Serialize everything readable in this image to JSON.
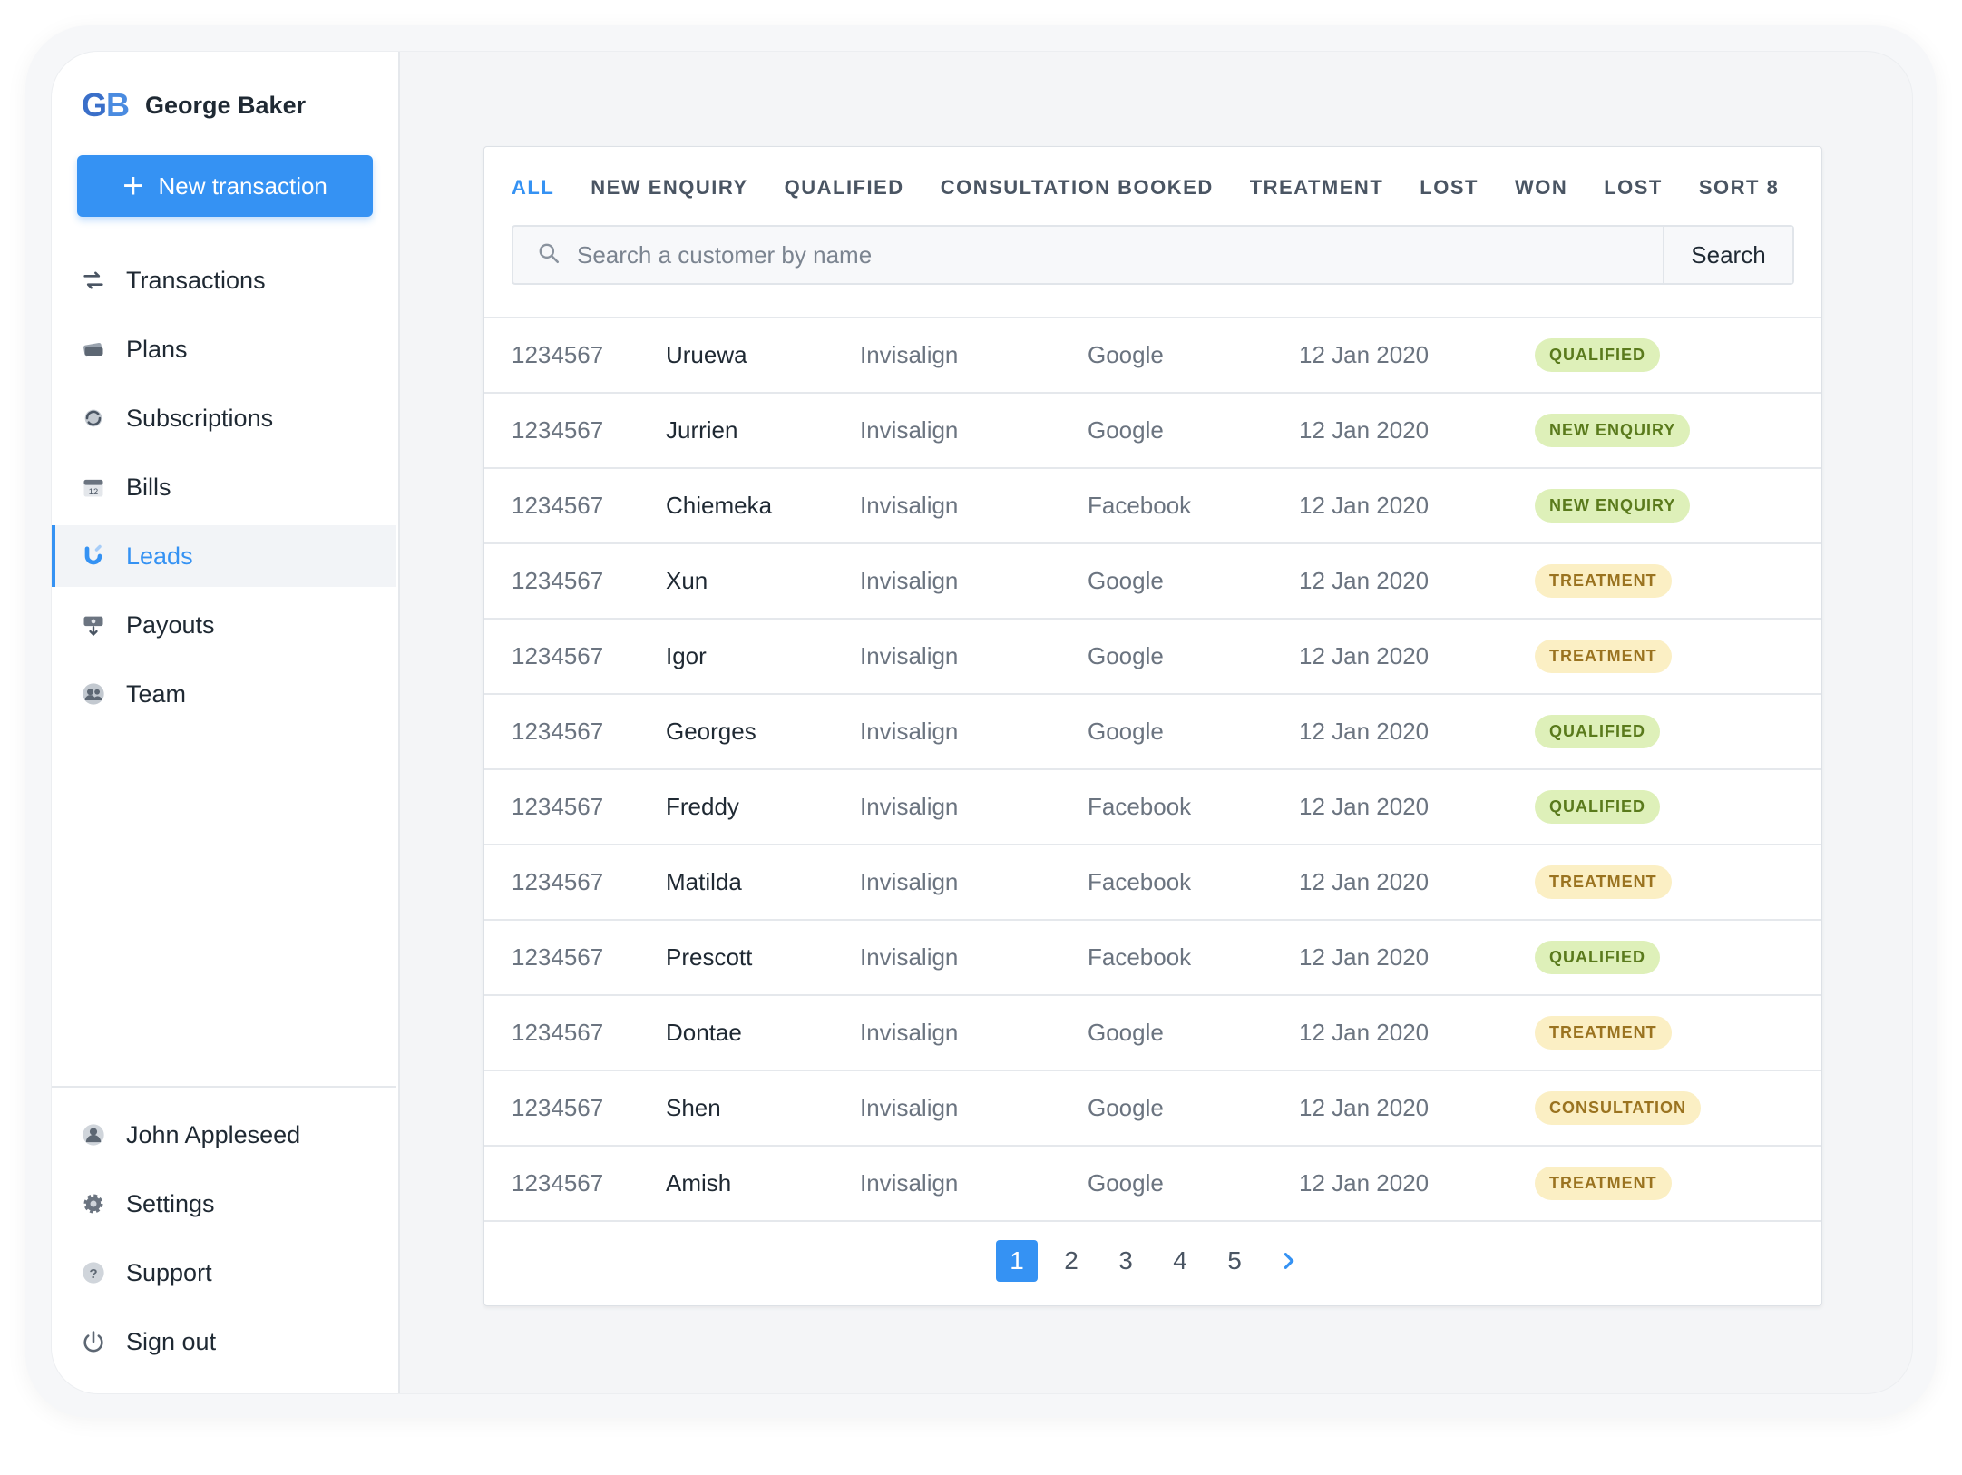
{
  "brand": {
    "logo": "GB",
    "name": "George Baker"
  },
  "new_transaction": {
    "label": "New transaction"
  },
  "nav": [
    {
      "label": "Transactions",
      "icon": "transfer-arrows-icon"
    },
    {
      "label": "Plans",
      "icon": "stack-icon"
    },
    {
      "label": "Subscriptions",
      "icon": "refresh-icon"
    },
    {
      "label": "Bills",
      "icon": "calendar-icon"
    },
    {
      "label": "Leads",
      "icon": "magnet-icon",
      "active": true
    },
    {
      "label": "Payouts",
      "icon": "payout-icon"
    },
    {
      "label": "Team",
      "icon": "team-icon"
    }
  ],
  "nav_bottom": [
    {
      "label": "John Appleseed",
      "icon": "user-icon"
    },
    {
      "label": "Settings",
      "icon": "gear-icon"
    },
    {
      "label": "Support",
      "icon": "question-icon"
    },
    {
      "label": "Sign out",
      "icon": "power-icon"
    }
  ],
  "tabs": [
    "ALL",
    "NEW ENQUIRY",
    "QUALIFIED",
    "CONSULTATION BOOKED",
    "TREATMENT",
    "LOST",
    "WON",
    "LOST",
    "SORT 8"
  ],
  "search": {
    "placeholder": "Search a customer by name",
    "button": "Search"
  },
  "rows": [
    {
      "id": "1234567",
      "name": "Uruewa",
      "product": "Invisalign",
      "source": "Google",
      "date": "12 Jan 2020",
      "status": "QUALIFIED"
    },
    {
      "id": "1234567",
      "name": "Jurrien",
      "product": "Invisalign",
      "source": "Google",
      "date": "12 Jan 2020",
      "status": "NEW ENQUIRY"
    },
    {
      "id": "1234567",
      "name": "Chiemeka",
      "product": "Invisalign",
      "source": "Facebook",
      "date": "12 Jan 2020",
      "status": "NEW ENQUIRY"
    },
    {
      "id": "1234567",
      "name": "Xun",
      "product": "Invisalign",
      "source": "Google",
      "date": "12 Jan 2020",
      "status": "TREATMENT"
    },
    {
      "id": "1234567",
      "name": "Igor",
      "product": "Invisalign",
      "source": "Google",
      "date": "12 Jan 2020",
      "status": "TREATMENT"
    },
    {
      "id": "1234567",
      "name": "Georges",
      "product": "Invisalign",
      "source": "Google",
      "date": "12 Jan 2020",
      "status": "QUALIFIED"
    },
    {
      "id": "1234567",
      "name": "Freddy",
      "product": "Invisalign",
      "source": "Facebook",
      "date": "12 Jan 2020",
      "status": "QUALIFIED"
    },
    {
      "id": "1234567",
      "name": "Matilda",
      "product": "Invisalign",
      "source": "Facebook",
      "date": "12 Jan 2020",
      "status": "TREATMENT"
    },
    {
      "id": "1234567",
      "name": "Prescott",
      "product": "Invisalign",
      "source": "Facebook",
      "date": "12 Jan 2020",
      "status": "QUALIFIED"
    },
    {
      "id": "1234567",
      "name": "Dontae",
      "product": "Invisalign",
      "source": "Google",
      "date": "12 Jan 2020",
      "status": "TREATMENT"
    },
    {
      "id": "1234567",
      "name": "Shen",
      "product": "Invisalign",
      "source": "Google",
      "date": "12 Jan 2020",
      "status": "CONSULTATION"
    },
    {
      "id": "1234567",
      "name": "Amish",
      "product": "Invisalign",
      "source": "Google",
      "date": "12 Jan 2020",
      "status": "TREATMENT"
    }
  ],
  "pagination": {
    "pages": [
      "1",
      "2",
      "3",
      "4",
      "5"
    ],
    "current": "1",
    "next_icon": "chevron-right-icon"
  },
  "colors": {
    "accent": "#3592f3",
    "qualified_bg": "#def0b9",
    "treatment_bg": "#fbefc4"
  }
}
